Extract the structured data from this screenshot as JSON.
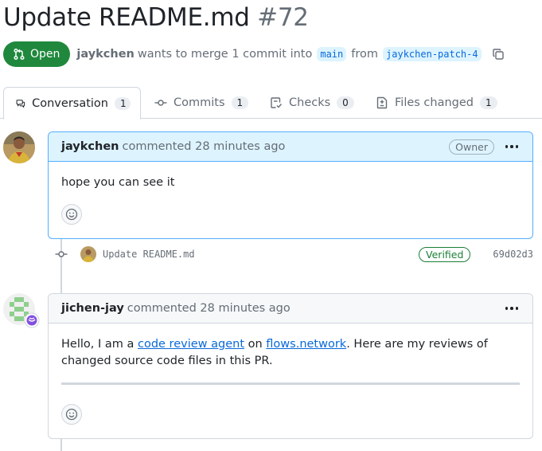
{
  "pr": {
    "title": "Update README.md",
    "number": "#72",
    "state": "Open",
    "author": "jaykchen",
    "merge_text": "wants to merge 1 commit into",
    "base_branch": "main",
    "from_text": "from",
    "head_branch": "jaykchen-patch-4"
  },
  "tabs": [
    {
      "label": "Conversation",
      "count": "1",
      "icon": "conversation-icon"
    },
    {
      "label": "Commits",
      "count": "1",
      "icon": "commit-icon"
    },
    {
      "label": "Checks",
      "count": "0",
      "icon": "checks-icon"
    },
    {
      "label": "Files changed",
      "count": "1",
      "icon": "file-diff-icon"
    }
  ],
  "comment1": {
    "author": "jaykchen",
    "action": "commented",
    "time": "28 minutes ago",
    "badge": "Owner",
    "body": "hope you can see it"
  },
  "commit": {
    "message": "Update README.md",
    "status": "Verified",
    "sha": "69d02d3"
  },
  "comment2": {
    "author": "jichen-jay",
    "action": "commented",
    "time": "28 minutes ago",
    "body_prefix": "Hello, I am a",
    "link1": "code review agent",
    "body_mid": "on",
    "link2": "flows.network",
    "body_suffix": ". Here are my reviews of changed source code files in this PR."
  },
  "colors": {
    "open_green": "#1f883d",
    "link_blue": "#0969da",
    "owner_header_bg": "#ddf4ff",
    "verified_green": "#1a7f37"
  }
}
